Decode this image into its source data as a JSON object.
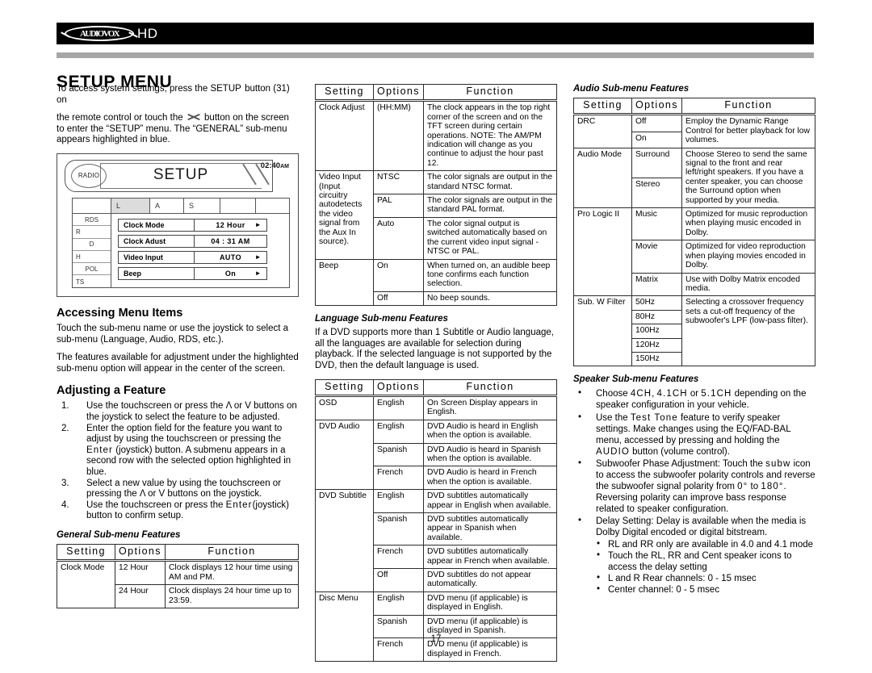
{
  "header": {
    "logo_word": "AUDIOVOX",
    "logo_suffix": "HD",
    "title": "SETUP MENU"
  },
  "page_number": "17",
  "left_column": {
    "intro_p1_a": "To access system settings, press the SETUP",
    "intro_p1_b": "button (31) on",
    "intro_p2_a": "the remote control or touch the",
    "intro_p2_b": "button on the screen to enter the “SETUP” menu. The “GENERAL” sub-menu appears highlighted in blue.",
    "screen": {
      "source_label": "RADIO",
      "title": "SETUP",
      "clock": "02:40",
      "clock_ampm": "AM",
      "tabs": [
        "",
        "L",
        "A",
        "S",
        "",
        ""
      ],
      "side_items": [
        "RDS",
        "R",
        "D",
        "H",
        "POL",
        "TS"
      ],
      "fields": [
        {
          "label": "Clock Mode",
          "value": "12 Hour",
          "arrow": "►"
        },
        {
          "label": "Clock Adust",
          "value": "04 : 31 AM",
          "arrow": ""
        },
        {
          "label": "Video Input",
          "value": "AUTO",
          "arrow": "►"
        },
        {
          "label": "Beep",
          "value": "On",
          "arrow": "►"
        }
      ]
    },
    "accessing_heading": "Accessing Menu Items",
    "accessing_p1": "Touch the sub-menu name or use the joystick to select a sub-menu (Language, Audio, RDS, etc.).",
    "accessing_p2": "The features available for adjustment under the highlighted sub-menu option will appear in the center of the screen.",
    "adjusting_heading": "Adjusting a Feature",
    "steps": [
      {
        "num": "1.",
        "text": "Use the touchscreen or press the Λ or V buttons on the joystick to select the feature to be adjusted."
      },
      {
        "num": "2.",
        "text_a": "Enter the option field for the feature you want to adjust by using the touchscreen or pressing the ",
        "text_sp": "Enter",
        "text_b": " (joystick) button. A submenu appears in a second row with the selected option highlighted in blue."
      },
      {
        "num": "3.",
        "text": "Select a new value by using the touchscreen or pressing the Λ or V buttons on the joystick."
      },
      {
        "num": "4.",
        "text_a": "Use the touchscreen or press the ",
        "text_sp": "Enter",
        "text_b": "(joystick) button to confirm setup."
      }
    ],
    "general_table_heading": "General Sub-menu Features"
  },
  "tables": {
    "columns": [
      "Setting",
      "Options",
      "Function"
    ],
    "general_part1": {
      "rows": [
        {
          "setting": "Clock Mode",
          "span": 2,
          "options": [
            {
              "option": "12 Hour",
              "function": "Clock displays 12 hour time using AM and PM."
            },
            {
              "option": "24 Hour",
              "function": "Clock displays 24 hour time up to 23:59."
            }
          ]
        }
      ]
    },
    "general_part2": {
      "rows": [
        {
          "setting": "Clock Adjust",
          "span": 1,
          "options": [
            {
              "option": "(HH:MM)",
              "function": "The clock appears in the top right corner of the screen and on the TFT screen during certain operations. NOTE: The AM/PM indication will change as you continue to adjust the hour past 12."
            }
          ]
        },
        {
          "setting": "Video Input (Input circuitry autodetects the video signal from the Aux In source).",
          "span": 3,
          "options": [
            {
              "option": "NTSC",
              "function": "The color signals are output in the standard NTSC format."
            },
            {
              "option": "PAL",
              "function": "The color signals are output in the standard PAL format."
            },
            {
              "option": "Auto",
              "function": "The color signal output is switched automatically based on the current video input signal - NTSC or PAL."
            }
          ]
        },
        {
          "setting": "Beep",
          "span": 2,
          "options": [
            {
              "option": "On",
              "function": "When turned on, an audible beep tone confirms each function selection."
            },
            {
              "option": "Off",
              "function": "No beep sounds."
            }
          ]
        }
      ]
    },
    "language": {
      "heading": "Language Sub-menu Features",
      "intro": "If a DVD supports more than 1 Subtitle or Audio language, all the languages are available for selection during playback. If the selected language is not supported by the DVD, then the default language is used.",
      "rows": [
        {
          "setting": "OSD",
          "span": 1,
          "options": [
            {
              "option": "English",
              "function": "On Screen Display appears in English."
            }
          ]
        },
        {
          "setting": "DVD Audio",
          "span": 3,
          "options": [
            {
              "option": "English",
              "function": "DVD Audio is heard in English when the option is available."
            },
            {
              "option": "Spanish",
              "function": "DVD Audio is heard in Spanish when the option is available."
            },
            {
              "option": "French",
              "function": "DVD Audio is heard in French when the option is available."
            }
          ]
        },
        {
          "setting": "DVD Subtitle",
          "span": 4,
          "options": [
            {
              "option": "English",
              "function": "DVD subtitles automatically appear in English when available."
            },
            {
              "option": "Spanish",
              "function": "DVD subtitles automatically appear in Spanish when available."
            },
            {
              "option": "French",
              "function": "DVD subtitles automatically appear in French when available."
            },
            {
              "option": "Off",
              "function": "DVD subtitles do not appear automatically."
            }
          ]
        },
        {
          "setting": "Disc Menu",
          "span": 3,
          "options": [
            {
              "option": "English",
              "function": "DVD menu (if applicable) is displayed in English."
            },
            {
              "option": "Spanish",
              "function": "DVD menu (if applicable) is displayed in Spanish."
            },
            {
              "option": "French",
              "function": "DVD menu (if applicable) is displayed in French."
            }
          ]
        }
      ]
    },
    "audio": {
      "heading": "Audio Sub-menu Features",
      "rows": [
        {
          "setting": "DRC",
          "span": 2,
          "function": "Employ the Dynamic Range Control for better playback for low volumes.",
          "options": [
            "Off",
            "On"
          ]
        },
        {
          "setting": "Audio Mode",
          "span": 2,
          "function": "Choose Stereo to send the same signal to the front and rear left/right speakers. If you have a center speaker, you can choose the Surround option when supported by your media.",
          "options": [
            "Surround",
            "Stereo"
          ]
        },
        {
          "setting": "Pro Logic II",
          "span": 3,
          "per_option": [
            {
              "option": "Music",
              "function": "Optimized for music reproduction when playing music encoded in Dolby."
            },
            {
              "option": "Movie",
              "function": "Optimized for video reproduction when playing movies encoded in Dolby."
            },
            {
              "option": "Matrix",
              "function": "Use with Dolby Matrix encoded media."
            }
          ]
        },
        {
          "setting": "Sub. W Filter",
          "span": 5,
          "function": "Selecting a crossover frequency sets a cut-off frequency of the subwoofer's LPF (low-pass filter).",
          "options": [
            "50Hz",
            "80Hz",
            "100Hz",
            "120Hz",
            "150Hz"
          ]
        }
      ]
    }
  },
  "speaker": {
    "heading": "Speaker Sub-menu Features",
    "bullets": [
      {
        "text_a": "Choose ",
        "sp1": "4CH",
        "mid1": ", ",
        "sp2": "4.1CH",
        "mid2": " or ",
        "sp3": "5.1CH",
        "text_b": " depending on the speaker configuration in your vehicle."
      },
      {
        "text_a": "Use the ",
        "sp1": "Test Tone",
        "text_b": " feature to verify speaker settings. Make changes using the EQ/FAD-BAL menu, accessed by pressing and holding the ",
        "sp2": "AUDIO",
        "text_c": " button (volume control)."
      },
      {
        "text_a": "Subwoofer Phase Adjustment: Touch the ",
        "sp1": "subw",
        "text_b": " icon to access the subwoofer polarity controls and reverse the subwoofer signal polarity from ",
        "sp2": "0°",
        "mid": " to ",
        "sp3": "180°",
        "text_c": ". Reversing polarity can improve bass response related to speaker configuration."
      },
      {
        "text_a": "Delay Setting: Delay is available when the media is Dolby Digital encoded or digital bitstream.",
        "sub": [
          "RL and RR only are available in 4.0 and 4.1 mode",
          "Touch the RL, RR and Cent speaker icons to access the delay setting",
          "L and R Rear channels: 0 - 15 msec",
          "Center channel: 0 - 5 msec"
        ]
      }
    ]
  }
}
